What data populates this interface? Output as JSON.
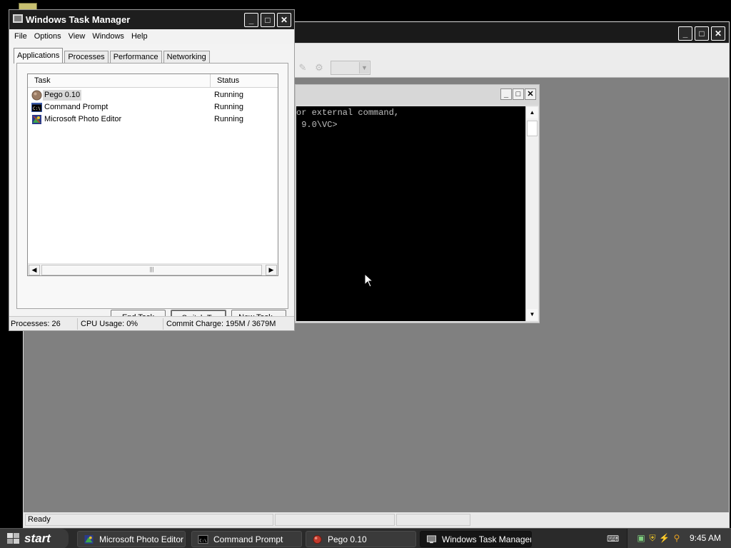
{
  "photo_editor": {
    "status_ready": "Ready"
  },
  "cmd": {
    "lines": [
      "or external command,",
      "",
      " 9.0\\VC>"
    ]
  },
  "task_manager": {
    "title": "Windows Task Manager",
    "menu": [
      "File",
      "Options",
      "View",
      "Windows",
      "Help"
    ],
    "tabs": [
      "Applications",
      "Processes",
      "Performance",
      "Networking"
    ],
    "columns": {
      "task": "Task",
      "status": "Status"
    },
    "rows": [
      {
        "task": "Pego 0.10",
        "status": "Running",
        "icon": "pego-icon"
      },
      {
        "task": "Command Prompt",
        "status": "Running",
        "icon": "command-prompt-icon"
      },
      {
        "task": "Microsoft Photo Editor",
        "status": "Running",
        "icon": "photo-editor-icon"
      }
    ],
    "buttons": {
      "end_task": "End Task",
      "switch_to": "Switch To",
      "new_task": "New Task..."
    },
    "status": {
      "processes": "Processes: 26",
      "cpu": "CPU Usage: 0%",
      "commit": "Commit Charge: 195M / 3679M"
    }
  },
  "taskbar": {
    "start": "start",
    "buttons": [
      {
        "label": "Microsoft Photo Editor",
        "icon": "photo-editor-icon"
      },
      {
        "label": "Command Prompt",
        "icon": "command-prompt-icon"
      },
      {
        "label": "Pego 0.10",
        "icon": "pego-icon"
      },
      {
        "label": "Windows Task Manager",
        "icon": "task-manager-icon"
      }
    ],
    "clock": "9:45 AM"
  }
}
